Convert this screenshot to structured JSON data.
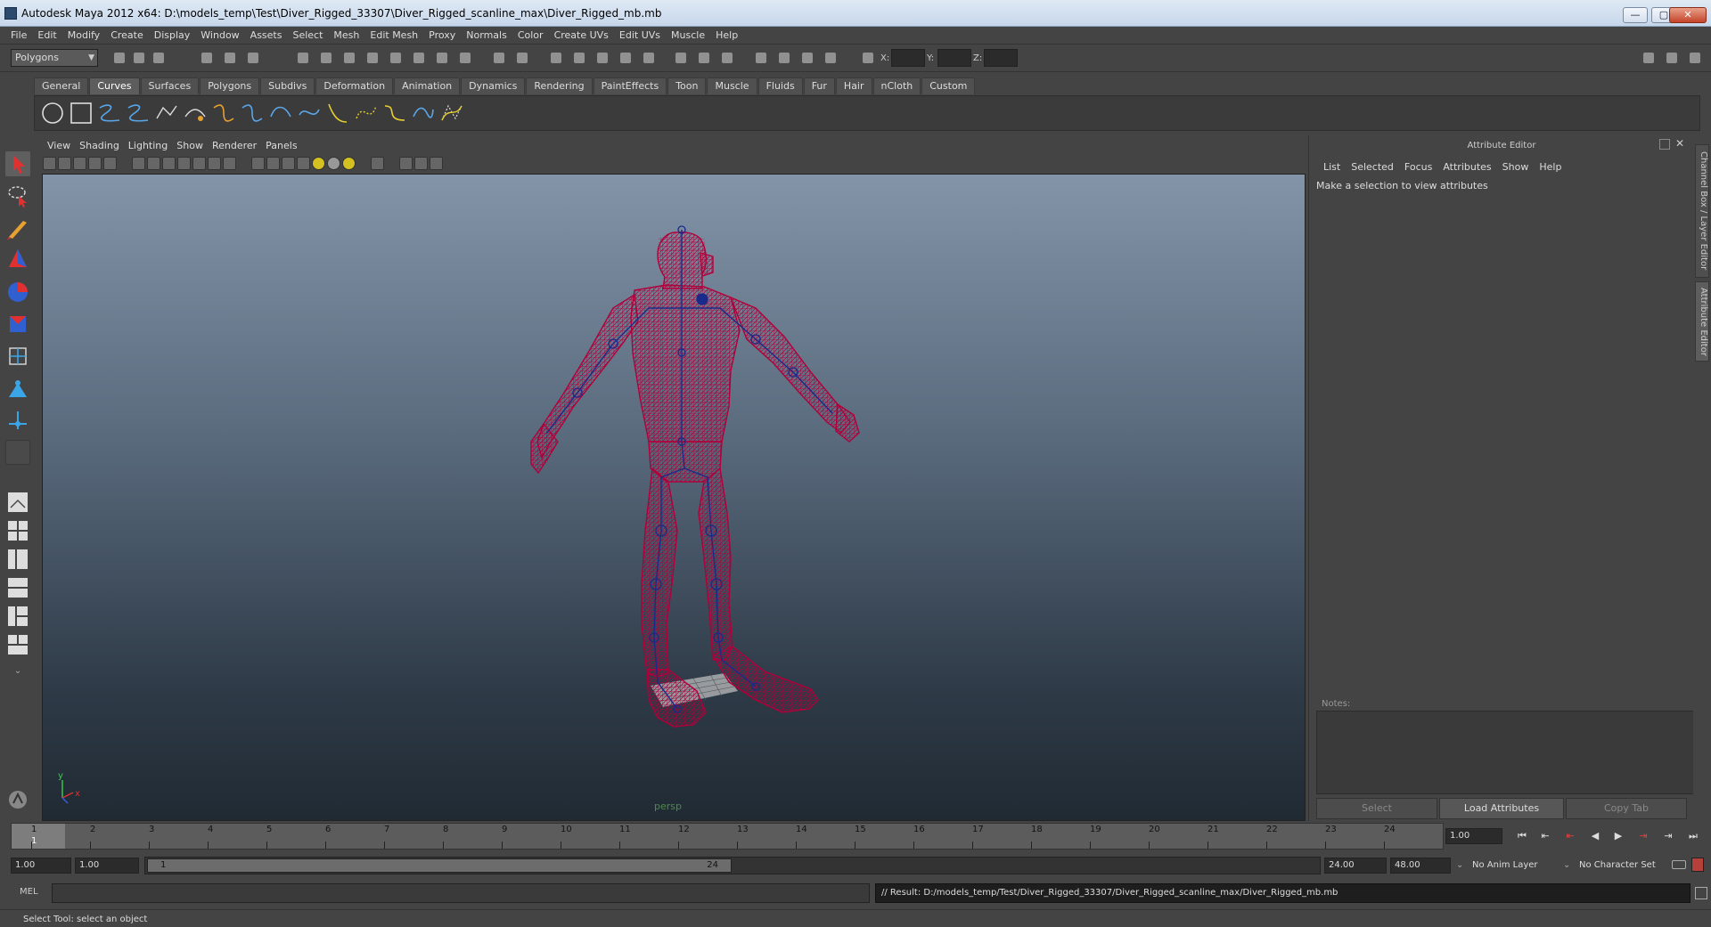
{
  "window": {
    "title": "Autodesk Maya 2012 x64: D:\\models_temp\\Test\\Diver_Rigged_33307\\Diver_Rigged_scanline_max\\Diver_Rigged_mb.mb",
    "minimize": "—",
    "maximize": "▢",
    "close": "✕"
  },
  "menubar": {
    "items": [
      "File",
      "Edit",
      "Modify",
      "Create",
      "Display",
      "Window",
      "Assets",
      "Select",
      "Mesh",
      "Edit Mesh",
      "Proxy",
      "Normals",
      "Color",
      "Create UVs",
      "Edit UVs",
      "Muscle",
      "Help"
    ]
  },
  "statusline": {
    "mode": "Polygons",
    "x_label": "X:",
    "y_label": "Y:",
    "z_label": "Z:"
  },
  "shelf": {
    "tabs": [
      "General",
      "Curves",
      "Surfaces",
      "Polygons",
      "Subdivs",
      "Deformation",
      "Animation",
      "Dynamics",
      "Rendering",
      "PaintEffects",
      "Toon",
      "Muscle",
      "Fluids",
      "Fur",
      "Hair",
      "nCloth",
      "Custom"
    ],
    "active_tab": "Curves"
  },
  "viewport": {
    "panel_menu": [
      "View",
      "Shading",
      "Lighting",
      "Show",
      "Renderer",
      "Panels"
    ],
    "camera_label": "persp",
    "axis_y": "y",
    "axis_x": "x",
    "wire_color": "#b0003a",
    "joint_color": "#1a2a8a"
  },
  "attribute_editor": {
    "title": "Attribute Editor",
    "menu": [
      "List",
      "Selected",
      "Focus",
      "Attributes",
      "Show",
      "Help"
    ],
    "message": "Make a selection to view attributes",
    "notes_label": "Notes:",
    "buttons": {
      "select": "Select",
      "load": "Load Attributes",
      "copy": "Copy Tab"
    }
  },
  "side_tabs": {
    "channel_box": "Channel Box / Layer Editor",
    "attribute_editor": "Attribute Editor"
  },
  "timeslider": {
    "ticks": [
      "1",
      "2",
      "3",
      "4",
      "5",
      "6",
      "7",
      "8",
      "9",
      "10",
      "11",
      "12",
      "13",
      "14",
      "15",
      "16",
      "17",
      "18",
      "19",
      "20",
      "21",
      "22",
      "23",
      "24"
    ],
    "current_frame": "1",
    "current_field": "1.00"
  },
  "rangeslider": {
    "start_time": "1.00",
    "playback_start": "1.00",
    "range_start_label": "1",
    "range_end_label": "24",
    "playback_end": "24.00",
    "end_time": "48.00",
    "anim_layer": "No Anim Layer",
    "character_set": "No Character Set"
  },
  "cmdline": {
    "label": "MEL",
    "result": "// Result: D:/models_temp/Test/Diver_Rigged_33307/Diver_Rigged_scanline_max/Diver_Rigged_mb.mb"
  },
  "helpline": {
    "text": "Select Tool: select an object"
  }
}
